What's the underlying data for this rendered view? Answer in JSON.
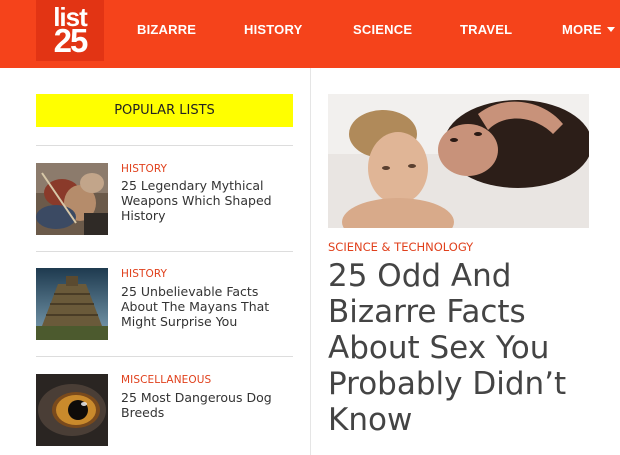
{
  "logo": {
    "line1": "list",
    "line2": "25"
  },
  "nav": {
    "items": [
      "BIZARRE",
      "HISTORY",
      "SCIENCE",
      "TRAVEL"
    ],
    "more": "MORE"
  },
  "popular": {
    "heading": "POPULAR LISTS",
    "items": [
      {
        "category": "HISTORY",
        "title": "25 Legendary Mythical Weapons Which Shaped History",
        "image_icon": "battle-painting"
      },
      {
        "category": "HISTORY",
        "title": "25 Unbelievable Facts About The Mayans That Might Surprise You",
        "image_icon": "mayan-pyramid"
      },
      {
        "category": "MISCELLANEOUS",
        "title": "25 Most Dangerous Dog Breeds",
        "image_icon": "dog-eye"
      }
    ]
  },
  "feature": {
    "category": "SCIENCE & TECHNOLOGY",
    "title": "25 Odd And Bizarre Facts About Sex You Probably Didn’t Know",
    "image_icon": "couple-photo"
  },
  "colors": {
    "header": "#f5431b",
    "logo_bg": "#e23414",
    "accent": "#e0401c",
    "popular_bg": "#ffff00"
  }
}
